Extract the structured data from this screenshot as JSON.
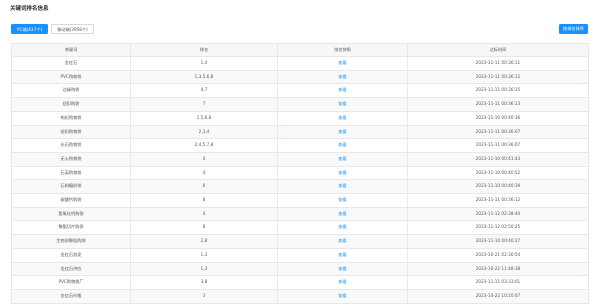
{
  "page": {
    "title": "关键词排名信息"
  },
  "tabs": [
    {
      "label": "PC端(437个)",
      "active": true
    },
    {
      "label": "移动端(3958个)",
      "active": false
    }
  ],
  "action_button": {
    "label": "按排名排序"
  },
  "table": {
    "headers": [
      "关键词",
      "排名",
      "排名快照",
      "达标时间"
    ],
    "view_label": "查看",
    "rows": [
      {
        "keyword": "金红石",
        "rank": "1,4",
        "time": "2023-11-11 00:36:11"
      },
      {
        "keyword": "PVC购物袋",
        "rank": "1,3,5,6,8",
        "time": "2023-11-11 00:36:12"
      },
      {
        "keyword": "边缘购袋",
        "rank": "4,7",
        "time": "2023-11-11 00:36:15"
      },
      {
        "keyword": "纽扣购袋",
        "rank": "7",
        "time": "2023-11-11 00:36:13"
      },
      {
        "keyword": "枸杞购物袋",
        "rank": "1,5,6,8",
        "time": "2023-11-10 00:40:36"
      },
      {
        "keyword": "纽扣购物袋",
        "rank": "2,3,4",
        "time": "2023-11-11 00:36:07"
      },
      {
        "keyword": "长石购物袋",
        "rank": "2,4,5,7,8",
        "time": "2023-11-11 00:36:07"
      },
      {
        "keyword": "无火购物袋",
        "rank": "4",
        "time": "2023-11-10 00:41:43"
      },
      {
        "keyword": "石英购物袋",
        "rank": "4",
        "time": "2023-11-10 00:40:52"
      },
      {
        "keyword": "石粉编织袋",
        "rank": "6",
        "time": "2023-11-10 00:40:39"
      },
      {
        "keyword": "碳酸钙购袋",
        "rank": "8",
        "time": "2023-11-11 00:36:12"
      },
      {
        "keyword": "氢氧化钙购袋",
        "rank": "4",
        "time": "2023-11-12 02:38:40"
      },
      {
        "keyword": "聚酯切片购袋",
        "rank": "8",
        "time": "2023-11-12 02:50:25"
      },
      {
        "keyword": "生物质颗粒购袋",
        "rank": "2,8",
        "time": "2023-11-10 00:40:27"
      },
      {
        "keyword": "金红石批发",
        "rank": "1,3",
        "time": "2023-10-21 02:30:54"
      },
      {
        "keyword": "金红石供应",
        "rank": "1,3",
        "time": "2023-10-22 11:48:38"
      },
      {
        "keyword": "PVC购物袋厂",
        "rank": "3,8",
        "time": "2023-11-11 03:33:01"
      },
      {
        "keyword": "金红石价格",
        "rank": "3",
        "time": "2023-10-22 10:10:07"
      }
    ]
  }
}
